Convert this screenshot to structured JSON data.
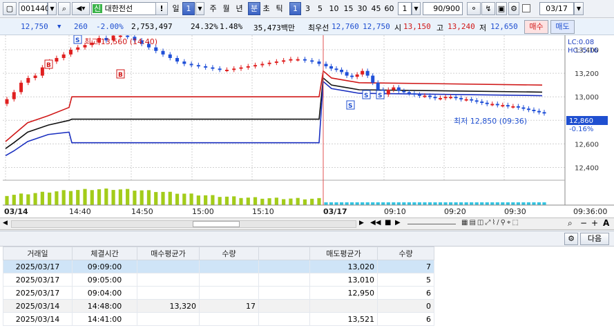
{
  "toolbar": {
    "code": "001440",
    "name_badge": "신",
    "name": "대한전선",
    "alert": "!",
    "period_tabs": [
      "일",
      "주",
      "월",
      "년",
      "분",
      "초",
      "틱"
    ],
    "period_value": "1",
    "minute_options": [
      "1",
      "3",
      "5",
      "10",
      "15",
      "30",
      "45",
      "60"
    ],
    "interval_value": "1",
    "count": "90/900",
    "checkbox_label": "",
    "date": "03/17"
  },
  "quote": {
    "price": "12,750",
    "change": "260",
    "change_pct": "-2.00%",
    "volume": "2,753,497",
    "turnover": "24.32%",
    "ratio": "1.48%",
    "amount": "35,473백만",
    "best_label": "최우선",
    "best_ask": "12,760",
    "best_bid": "12,750",
    "open_label": "시",
    "open": "13,150",
    "high_label": "고",
    "high": "13,240",
    "low_label": "저",
    "low": "12,650",
    "buy_btn": "매수",
    "sell_btn": "매도"
  },
  "chart_data": {
    "type": "candlestick",
    "y_axis_labels": [
      "13,400",
      "13,200",
      "13,000",
      "12,800",
      "12,600",
      "12,400"
    ],
    "ylim": [
      12350,
      13500
    ],
    "x_axis_labels": [
      "03/14",
      "14:40",
      "14:50",
      "15:00",
      "15:10",
      "03/17",
      "09:10",
      "09:20",
      "09:30",
      "09:36:00"
    ],
    "lc_label": "LC:0.08",
    "hc_label": "HC:-5.16",
    "max_annotation": "최고 13,560 (14:40)",
    "min_annotation": "최저 12,850 (09:36)",
    "current_price": "12,860",
    "current_pct": "-0.16%",
    "markers": [
      "B",
      "B",
      "S",
      "S",
      "S",
      "S"
    ],
    "closes": [
      12980,
      13040,
      13120,
      13160,
      13180,
      13250,
      13300,
      13330,
      13360,
      13400,
      13420,
      13440,
      13460,
      13500,
      13480,
      13520,
      13520,
      13510,
      13480,
      13450,
      13420,
      13390,
      13360,
      13330,
      13300,
      13280,
      13270,
      13260,
      13250,
      13240,
      13230,
      13230,
      13240,
      13250,
      13260,
      13270,
      13280,
      13290,
      13300,
      13310,
      13320,
      13320,
      13310,
      13300,
      13280,
      13260,
      13240,
      13230,
      13210,
      13180,
      13170,
      13190,
      13220,
      13180,
      13120,
      13060,
      13020,
      13060,
      13080,
      13050,
      13040,
      13030,
      13020,
      13010,
      13010,
      13000,
      12990,
      12990,
      13000,
      13000,
      12990,
      12980,
      12980,
      12970,
      12960,
      12950,
      12940,
      12940,
      12930,
      12930,
      12920,
      12920,
      12910,
      12900,
      12890,
      12880,
      12870,
      12860
    ],
    "ma_red_last": 13100,
    "ma_black_last": 13040,
    "ma_blue_last": 13010
  },
  "controls": {
    "zoom_plus": "+",
    "zoom_minus": "−",
    "text_btn": "A"
  },
  "table": {
    "next_btn": "다음",
    "columns": [
      "거래일",
      "체결시간",
      "매수평균가",
      "수량",
      "",
      "매도평균가",
      "수량"
    ],
    "rows": [
      {
        "date": "2025/03/17",
        "time": "09:09:00",
        "buy_avg": "",
        "buy_qty": "",
        "sell_avg": "13,020",
        "sell_qty": "7"
      },
      {
        "date": "2025/03/17",
        "time": "09:05:00",
        "buy_avg": "",
        "buy_qty": "",
        "sell_avg": "13,010",
        "sell_qty": "5"
      },
      {
        "date": "2025/03/17",
        "time": "09:04:00",
        "buy_avg": "",
        "buy_qty": "",
        "sell_avg": "12,950",
        "sell_qty": "6"
      },
      {
        "date": "2025/03/14",
        "time": "14:48:00",
        "buy_avg": "13,320",
        "buy_qty": "17",
        "sell_avg": "",
        "sell_qty": "0"
      },
      {
        "date": "2025/03/14",
        "time": "14:41:00",
        "buy_avg": "",
        "buy_qty": "",
        "sell_avg": "13,521",
        "sell_qty": "6"
      }
    ]
  }
}
